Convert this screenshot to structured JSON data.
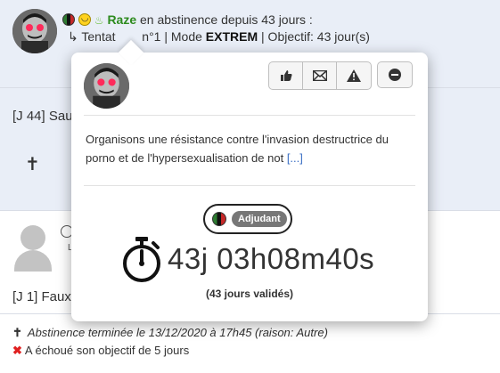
{
  "post1": {
    "username": "Raze",
    "status_text": "en abstinence depuis 43 jours :",
    "attempt_prefix": "↳ Tentat",
    "attempt_suffix": "n°1 | Mode",
    "mode": "EXTREM",
    "objective": "| Objectif: 43 jour(s)",
    "day_entry": "[J 44] Sau"
  },
  "popover": {
    "bio": "Organisons une résistance contre l'invasion destructrice du porno et de l'hypersexualisation de not",
    "more_link": "[...]",
    "rank": "Adjudant",
    "timer": "43j 03h08m40s",
    "validated": "(43 jours validés)",
    "buttons": [
      "like-icon",
      "envelope-icon",
      "warning-icon",
      "block-icon"
    ]
  },
  "post2": {
    "day_entry": "[J 1] Faux",
    "sub_initial": "L",
    "end_text": "Abstinence terminée le 13/12/2020 à 17h45 (raison: Autre)",
    "fail_text": "A échoué son objectif de 5 jours"
  },
  "colors": {
    "username": "#2e8b1f",
    "post_bg": "#e9eef7",
    "link": "#3a6fc4",
    "fail": "#e02020"
  }
}
